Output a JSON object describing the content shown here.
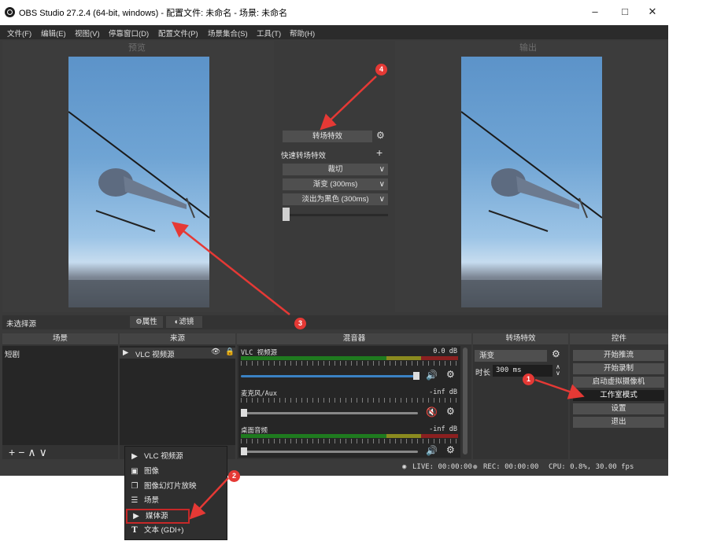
{
  "window": {
    "title": "OBS Studio 27.2.4 (64-bit, windows) - 配置文件: 未命名 - 场景: 未命名",
    "minimize": "–",
    "maximize": "□",
    "close": "✕"
  },
  "menu": [
    "文件(F)",
    "编辑(E)",
    "视图(V)",
    "停靠窗口(D)",
    "配置文件(P)",
    "场景集合(S)",
    "工具(T)",
    "帮助(H)"
  ],
  "preview": {
    "label": "预览"
  },
  "program": {
    "label": "输出"
  },
  "transition": {
    "button": "转场特效",
    "quick_label": "快速转场特效",
    "items": [
      "裁切",
      "渐变 (300ms)",
      "淡出为黑色 (300ms)"
    ]
  },
  "source_toolbar": {
    "no_source": "未选择源",
    "properties": "属性",
    "filters": "滤镜"
  },
  "docks": {
    "scenes": {
      "title": "场景",
      "items": [
        "短剧"
      ]
    },
    "sources": {
      "title": "来源",
      "items": [
        "VLC 视频源"
      ]
    },
    "mixer": {
      "title": "混音器",
      "channels": [
        {
          "name": "VLC 视频源",
          "level": "0.0 dB"
        },
        {
          "name": "麦克风/Aux",
          "level": "-inf dB"
        },
        {
          "name": "桌面音频",
          "level": "-inf dB"
        }
      ]
    },
    "transitions": {
      "title": "转场特效",
      "selected": "渐变",
      "duration_label": "时长",
      "duration_value": "300 ms"
    },
    "controls": {
      "title": "控件",
      "buttons": [
        "开始推流",
        "开始录制",
        "启动虚拟摄像机",
        "工作室模式",
        "设置",
        "退出"
      ]
    }
  },
  "status": {
    "live": "LIVE: 00:00:00",
    "rec": "REC: 00:00:00",
    "cpu": "CPU: 0.8%, 30.00 fps"
  },
  "context_menu": [
    "VLC 视频源",
    "图像",
    "图像幻灯片放映",
    "场景",
    "媒体源",
    "文本 (GDI+)"
  ],
  "annotations": [
    "1",
    "2",
    "3",
    "4"
  ],
  "colors": {
    "annotation": "#e53935",
    "meter_green": "#1f7a1f",
    "meter_red": "#8a2020",
    "selected_button": "#1e1e1e"
  }
}
